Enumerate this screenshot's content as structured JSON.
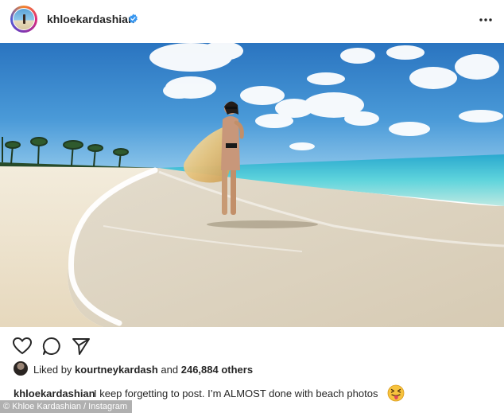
{
  "post": {
    "username": "khloekardashian",
    "photo_alt": "Woman in sunglasses holding a flowing sarong on a white-sand beach with turquoise water"
  },
  "likes": {
    "prefix": "Liked by ",
    "liker": "kourtneykardash",
    "connector": " and ",
    "others": "246,884 others"
  },
  "caption": {
    "username": "khloekardashian",
    "text": "I keep forgetting to post. I’m ALMOST done with beach photos"
  },
  "credit": "© Khloe Kardashian / Instagram",
  "colors": {
    "verified_badge": "#3897f0",
    "text": "#262626",
    "sky": "#2f82c9",
    "ocean": "#36c2d9",
    "sand": "#efe6d3"
  },
  "icons": {
    "verified": "verified-badge-icon",
    "more": "more-options-icon",
    "like": "heart-icon",
    "comment": "comment-icon",
    "share": "paper-plane-icon",
    "emoji": "tongue-out-emoji-icon"
  }
}
